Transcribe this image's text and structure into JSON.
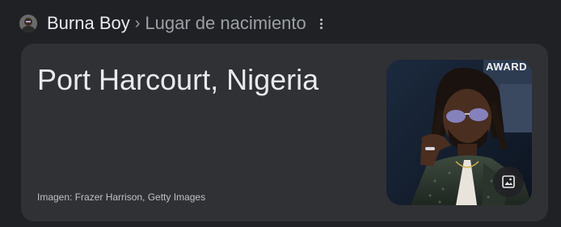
{
  "header": {
    "avatar_icon": "person-avatar-icon",
    "entity": "Burna Boy",
    "separator": "›",
    "attribute": "Lugar de nacimiento",
    "more_icon": "more-vert-icon"
  },
  "card": {
    "answer": "Port Harcourt, Nigeria",
    "image_credit": "Imagen: Frazer Harrison, Getty Images",
    "photo_backdrop_text": "AWARD",
    "image_button_icon": "image-icon"
  },
  "colors": {
    "page_bg": "#202124",
    "card_bg": "#303134",
    "primary_text": "#e8eaed",
    "secondary_text": "#9aa0a6"
  }
}
